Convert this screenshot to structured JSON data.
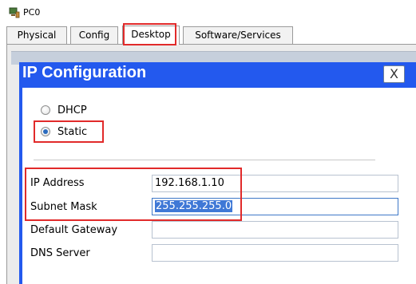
{
  "window": {
    "title": "PC0",
    "icon": "pc-icon"
  },
  "tabs": [
    {
      "label": "Physical",
      "active": false
    },
    {
      "label": "Config",
      "active": false
    },
    {
      "label": "Desktop",
      "active": true
    },
    {
      "label": "Software/Services",
      "active": false
    }
  ],
  "dialog": {
    "title": "IP Configuration",
    "close_label": "X",
    "radios": [
      {
        "label": "DHCP",
        "checked": false
      },
      {
        "label": "Static",
        "checked": true
      }
    ],
    "fields": [
      {
        "label": "IP Address",
        "value": "192.168.1.10"
      },
      {
        "label": "Subnet Mask",
        "value": "255.255.255.0",
        "selected": true
      },
      {
        "label": "Default Gateway",
        "value": ""
      },
      {
        "label": "DNS Server",
        "value": ""
      }
    ]
  },
  "colors": {
    "dialog_title_bar": "#2359ee",
    "highlight": "#e12a2a",
    "selection": "#3f78d6"
  }
}
